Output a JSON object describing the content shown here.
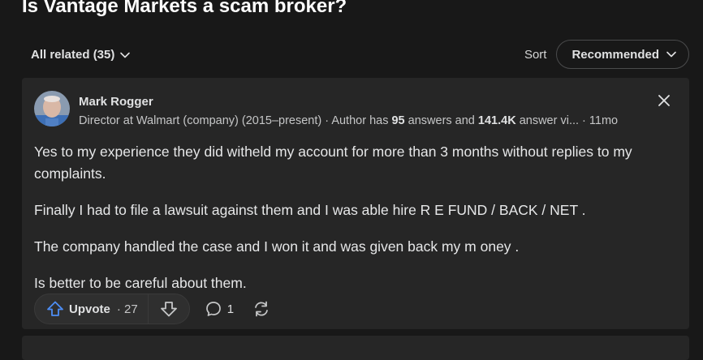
{
  "question": {
    "title": "Is Vantage Markets a scam broker?"
  },
  "related": {
    "label": "All related (35)"
  },
  "sort": {
    "label": "Sort",
    "selected": "Recommended"
  },
  "answer": {
    "author_name": "Mark Rogger",
    "credential_prefix": "Director at Walmart (company) (2015–present) · Author has ",
    "answer_count": "95",
    "credential_mid": " answers and ",
    "view_count": "141.4K",
    "credential_suffix": " answer vi...",
    "age": " · 11mo",
    "paragraphs": [
      "Yes to my experience they did witheld my account for more than 3 months without replies to my complaints.",
      "Finally I had to file a lawsuit against them and I was able hire R E FUND / BACK / NET .",
      "The company handled the case and I won it and was given back my m oney .",
      "Is better to be careful about them."
    ],
    "upvote_label": "Upvote",
    "upvote_sep": " · ",
    "upvote_count": "27",
    "comment_count": "1"
  },
  "icons": {
    "chevron": "chevron-down-icon",
    "close": "close-icon",
    "upvote": "arrow-up-icon",
    "downvote": "arrow-down-icon",
    "comment": "comment-bubble-icon",
    "share": "share-cycle-icon"
  },
  "colors": {
    "background": "#181818",
    "card": "#262626",
    "upvote_accent": "#4d8ef6",
    "text": "#e6e7e8"
  }
}
